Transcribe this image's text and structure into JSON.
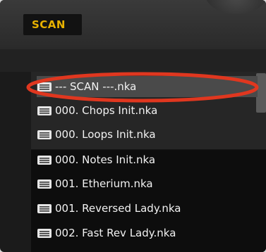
{
  "header": {
    "scan_tab_label": "SCAN"
  },
  "file_list": {
    "items": [
      {
        "label": "--- SCAN ---.nka",
        "selected": true
      },
      {
        "label": "000. Chops Init.nka"
      },
      {
        "label": "000. Loops Init.nka"
      },
      {
        "label": "000. Notes Init.nka"
      },
      {
        "label": "001. Etherium.nka"
      },
      {
        "label": "001. Reversed Lady.nka"
      },
      {
        "label": "002. Fast Rev Lady.nka"
      }
    ]
  },
  "colors": {
    "accent": "#e7b100",
    "annotation": "#e0371f"
  },
  "icons": {
    "row_icon": "list-file-icon"
  }
}
